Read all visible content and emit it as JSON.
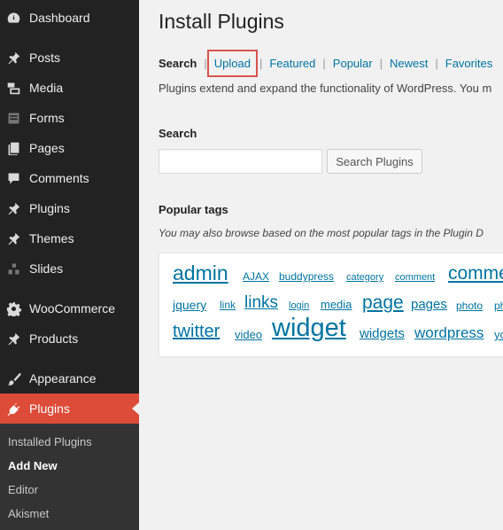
{
  "sidebar": {
    "items": [
      {
        "label": "Dashboard",
        "icon": "dashboard-icon"
      },
      {
        "label": "Posts",
        "icon": "pin-icon"
      },
      {
        "label": "Media",
        "icon": "media-icon"
      },
      {
        "label": "Forms",
        "icon": "forms-icon"
      },
      {
        "label": "Pages",
        "icon": "pages-icon"
      },
      {
        "label": "Comments",
        "icon": "comments-icon"
      },
      {
        "label": "Plugins",
        "icon": "pin-icon"
      },
      {
        "label": "Themes",
        "icon": "pin-icon"
      },
      {
        "label": "Slides",
        "icon": "slides-icon"
      },
      {
        "label": "WooCommerce",
        "icon": "gear-icon"
      },
      {
        "label": "Products",
        "icon": "pin-icon"
      },
      {
        "label": "Appearance",
        "icon": "brush-icon"
      },
      {
        "label": "Plugins",
        "icon": "plug-icon"
      }
    ],
    "submenu": [
      "Installed Plugins",
      "Add New",
      "Editor",
      "Akismet"
    ]
  },
  "main": {
    "title": "Install Plugins",
    "tabs": [
      "Search",
      "Upload",
      "Featured",
      "Popular",
      "Newest",
      "Favorites"
    ],
    "intro": "Plugins extend and expand the functionality of WordPress. You m",
    "search_label": "Search",
    "search_placeholder": "",
    "search_button": "Search Plugins",
    "tags_heading": "Popular tags",
    "tags_intro": "You may also browse based on the most popular tags in the Plugin D",
    "tags": [
      "admin",
      "AJAX",
      "buddypress",
      "category",
      "comment",
      "comme",
      "jquery",
      "link",
      "links",
      "login",
      "media",
      "page",
      "pages",
      "photo",
      "ph",
      "twitter",
      "video",
      "widget",
      "widgets",
      "wordpress",
      "yo"
    ]
  },
  "colors": {
    "sidebar_bg": "#222222",
    "active_menu": "#dd4b39",
    "link": "#0074a2",
    "highlight_box": "#d9534f"
  }
}
